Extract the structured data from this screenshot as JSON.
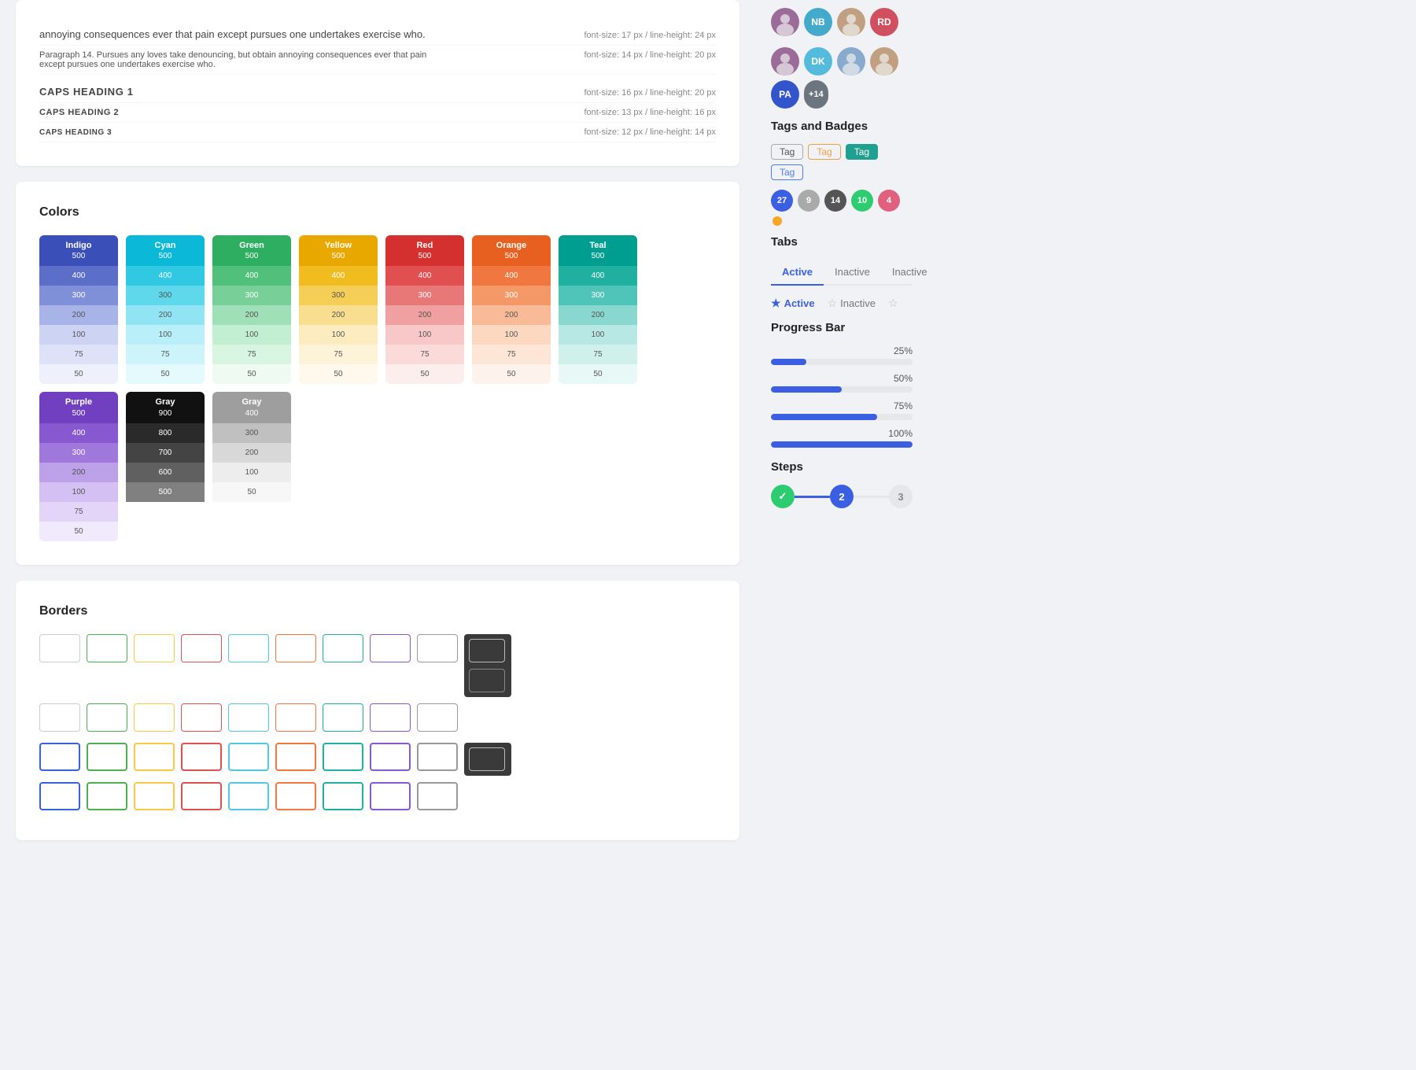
{
  "typography": {
    "paragraphs": [
      {
        "text": "annoying consequences ever that pain except pursues one undertakes exercise who.",
        "meta": "font-size: 17 px / line-height: 24 px"
      },
      {
        "text": "Paragraph 14. Pursues any loves take denouncing, but obtain annoying consequences ever that pain except pursues one undertakes exercise who.",
        "meta": "font-size: 14 px / line-height: 20 px"
      }
    ],
    "caps_headings": [
      {
        "label": "CAPS HEADING 1",
        "meta": "font-size: 16 px / line-height: 20 px"
      },
      {
        "label": "CAPS HEADING 2",
        "meta": "font-size: 13 px / line-height: 16 px"
      },
      {
        "label": "CAPS HEADING 3",
        "meta": "font-size: 12 px / line-height: 14 px"
      }
    ]
  },
  "colors_section": {
    "title": "Colors",
    "columns": [
      {
        "name": "Indigo",
        "shades": [
          {
            "num": "500",
            "hex": "#3b4fb8",
            "light": false
          },
          {
            "num": "400",
            "hex": "#5c6fc8",
            "light": false
          },
          {
            "num": "300",
            "hex": "#8090d8",
            "light": false
          },
          {
            "num": "200",
            "hex": "#a8b3e8",
            "light": true
          },
          {
            "num": "100",
            "hex": "#ccd3f3",
            "light": true
          },
          {
            "num": "75",
            "hex": "#dde2f8",
            "light": true
          },
          {
            "num": "50",
            "hex": "#eeF0fc",
            "light": true
          }
        ]
      },
      {
        "name": "Cyan",
        "shades": [
          {
            "num": "500",
            "hex": "#0bb8d8",
            "light": false
          },
          {
            "num": "400",
            "hex": "#30c8e2",
            "light": false
          },
          {
            "num": "300",
            "hex": "#60d8ec",
            "light": true
          },
          {
            "num": "200",
            "hex": "#90e4f3",
            "light": true
          },
          {
            "num": "100",
            "hex": "#b8eff8",
            "light": true
          },
          {
            "num": "75",
            "hex": "#cef4fb",
            "light": true
          },
          {
            "num": "50",
            "hex": "#e5fafd",
            "light": true
          }
        ]
      },
      {
        "name": "Green",
        "shades": [
          {
            "num": "500",
            "hex": "#2eae60",
            "light": false
          },
          {
            "num": "400",
            "hex": "#50c07a",
            "light": false
          },
          {
            "num": "300",
            "hex": "#78d098",
            "light": false
          },
          {
            "num": "200",
            "hex": "#a0e0b8",
            "light": true
          },
          {
            "num": "100",
            "hex": "#c2efd2",
            "light": true
          },
          {
            "num": "75",
            "hex": "#d8f5e2",
            "light": true
          },
          {
            "num": "50",
            "hex": "#eefaf2",
            "light": true
          }
        ]
      },
      {
        "name": "Yellow",
        "shades": [
          {
            "num": "500",
            "hex": "#e8a800",
            "light": false
          },
          {
            "num": "400",
            "hex": "#f0bc20",
            "light": false
          },
          {
            "num": "300",
            "hex": "#f5ce58",
            "light": true
          },
          {
            "num": "200",
            "hex": "#f9de90",
            "light": true
          },
          {
            "num": "100",
            "hex": "#fcecc0",
            "light": true
          },
          {
            "num": "75",
            "hex": "#fdf3d8",
            "light": true
          },
          {
            "num": "50",
            "hex": "#fef9ec",
            "light": true
          }
        ]
      },
      {
        "name": "Red",
        "shades": [
          {
            "num": "500",
            "hex": "#d43030",
            "light": false
          },
          {
            "num": "400",
            "hex": "#e05050",
            "light": false
          },
          {
            "num": "300",
            "hex": "#e87878",
            "light": false
          },
          {
            "num": "200",
            "hex": "#f0a0a0",
            "light": true
          },
          {
            "num": "100",
            "hex": "#f8c8c8",
            "light": true
          },
          {
            "num": "75",
            "hex": "#fbdada",
            "light": true
          },
          {
            "num": "50",
            "hex": "#fdeeee",
            "light": true
          }
        ]
      },
      {
        "name": "Orange",
        "shades": [
          {
            "num": "500",
            "hex": "#e86020",
            "light": false
          },
          {
            "num": "400",
            "hex": "#f07840",
            "light": false
          },
          {
            "num": "300",
            "hex": "#f59868",
            "light": false
          },
          {
            "num": "200",
            "hex": "#f9ba98",
            "light": true
          },
          {
            "num": "100",
            "hex": "#fcd8c0",
            "light": true
          },
          {
            "num": "75",
            "hex": "#fde6d5",
            "light": true
          },
          {
            "num": "50",
            "hex": "#fef3ec",
            "light": true
          }
        ]
      },
      {
        "name": "Teal",
        "shades": [
          {
            "num": "500",
            "hex": "#009e90",
            "light": false
          },
          {
            "num": "400",
            "hex": "#20b0a0",
            "light": false
          },
          {
            "num": "300",
            "hex": "#50c4b8",
            "light": false
          },
          {
            "num": "200",
            "hex": "#88d8d0",
            "light": true
          },
          {
            "num": "100",
            "hex": "#b8e8e4",
            "light": true
          },
          {
            "num": "75",
            "hex": "#d0f0ec",
            "light": true
          },
          {
            "num": "50",
            "hex": "#e8f8f6",
            "light": true
          }
        ]
      },
      {
        "name": "Purple",
        "shades": [
          {
            "num": "500",
            "hex": "#7040c0",
            "light": false
          },
          {
            "num": "400",
            "hex": "#8858d0",
            "light": false
          },
          {
            "num": "300",
            "hex": "#a078dc",
            "light": false
          },
          {
            "num": "200",
            "hex": "#bca0e8",
            "light": true
          },
          {
            "num": "100",
            "hex": "#d4c0f3",
            "light": true
          },
          {
            "num": "75",
            "hex": "#e3d5f8",
            "light": true
          },
          {
            "num": "50",
            "hex": "#f1eafc",
            "light": true
          }
        ]
      },
      {
        "name": "Gray",
        "dark": true,
        "shades": [
          {
            "num": "900",
            "hex": "#111111",
            "light": false
          },
          {
            "num": "800",
            "hex": "#2a2a2a",
            "light": false
          },
          {
            "num": "700",
            "hex": "#444444",
            "light": false
          },
          {
            "num": "600",
            "hex": "#606060",
            "light": false
          },
          {
            "num": "500",
            "hex": "#808080",
            "light": false
          }
        ]
      },
      {
        "name": "Gray",
        "dark": false,
        "shades": [
          {
            "num": "400",
            "hex": "#9e9e9e",
            "light": false
          },
          {
            "num": "300",
            "hex": "#c0c0c0",
            "light": true
          },
          {
            "num": "200",
            "hex": "#d8d8d8",
            "light": true
          },
          {
            "num": "100",
            "hex": "#ededed",
            "light": true
          },
          {
            "num": "50",
            "hex": "#f7f7f7",
            "light": true
          }
        ]
      }
    ]
  },
  "borders_section": {
    "title": "Borders"
  },
  "sidebar": {
    "avatar_rows": [
      {
        "avatars": [
          {
            "type": "img",
            "bg": "#9b6b9a",
            "label": "P1"
          },
          {
            "type": "initials",
            "bg": "#44aacc",
            "initials": "NB"
          },
          {
            "type": "img",
            "bg": "#c0a080",
            "label": "P3"
          },
          {
            "type": "initials",
            "bg": "#d05060",
            "initials": "RD"
          }
        ]
      },
      {
        "avatars": [
          {
            "type": "img",
            "bg": "#9b6b9a",
            "label": "P1"
          },
          {
            "type": "initials",
            "bg": "#55bbdd",
            "initials": "DK"
          },
          {
            "type": "img",
            "bg": "#88aacc",
            "label": "P3"
          },
          {
            "type": "img",
            "bg": "#c0a080",
            "label": "P4"
          },
          {
            "type": "initials",
            "bg": "#3355cc",
            "initials": "PA"
          }
        ],
        "count": "+14"
      }
    ],
    "tags_badges": {
      "title": "Tags and Badges",
      "tags": [
        {
          "label": "Tag",
          "style": "gray"
        },
        {
          "label": "Tag",
          "style": "orange"
        },
        {
          "label": "Tag",
          "style": "teal"
        },
        {
          "label": "Tag",
          "style": "blue"
        }
      ],
      "badges": [
        {
          "value": "27",
          "style": "badge-blue"
        },
        {
          "value": "9",
          "style": "badge-gray"
        },
        {
          "value": "14",
          "style": "badge-dark"
        },
        {
          "value": "10",
          "style": "badge-green"
        },
        {
          "value": "4",
          "style": "badge-pink"
        }
      ]
    },
    "tabs": {
      "title": "Tabs",
      "tab_row1": [
        {
          "label": "Active",
          "active": true
        },
        {
          "label": "Inactive",
          "active": false
        },
        {
          "label": "Inactive",
          "active": false
        }
      ],
      "tab_row2": [
        {
          "label": "Active",
          "active": true,
          "filled_star": true
        },
        {
          "label": "Inactive",
          "active": false,
          "filled_star": false
        },
        {
          "label": "",
          "active": false,
          "filled_star": false,
          "star_only": true
        }
      ]
    },
    "progress": {
      "title": "Progress Bar",
      "items": [
        {
          "label": "25%",
          "value": 25
        },
        {
          "label": "50%",
          "value": 50
        },
        {
          "label": "75%",
          "value": 75
        },
        {
          "label": "100%",
          "value": 100
        }
      ]
    },
    "steps": {
      "title": "Steps",
      "step1_icon": "✓",
      "step2_label": "2"
    }
  }
}
